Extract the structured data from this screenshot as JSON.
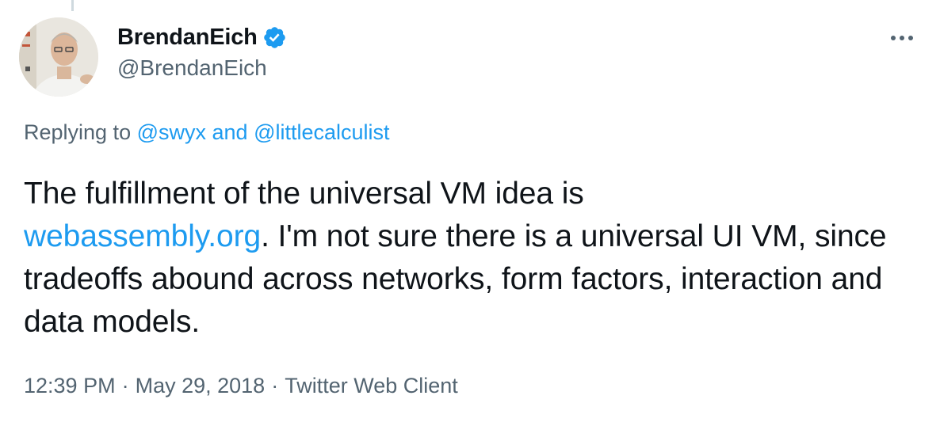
{
  "author": {
    "display_name": "BrendanEich",
    "handle": "@BrendanEich",
    "verified": true,
    "verified_icon": "verified-badge-icon",
    "avatar_icon": "profile-photo"
  },
  "menu": {
    "icon": "more-options-icon"
  },
  "reply": {
    "prefix": "Replying to ",
    "user1": "@swyx",
    "joiner": " and ",
    "user2": "@littlecalculist"
  },
  "tweet": {
    "line_before_link": "The fulfillment of the universal VM idea is ",
    "link_text": "webassembly.org",
    "text_after_link": ". I'm not sure there is a universal UI VM, since tradeoffs abound across networks, form factors, interaction and data models."
  },
  "meta": {
    "time": "12:39 PM",
    "separator": "·",
    "date": "May 29, 2018",
    "client": "Twitter Web Client"
  },
  "colors": {
    "accent": "#1d9bf0",
    "secondary_text": "#536471",
    "primary_text": "#0f1419"
  }
}
